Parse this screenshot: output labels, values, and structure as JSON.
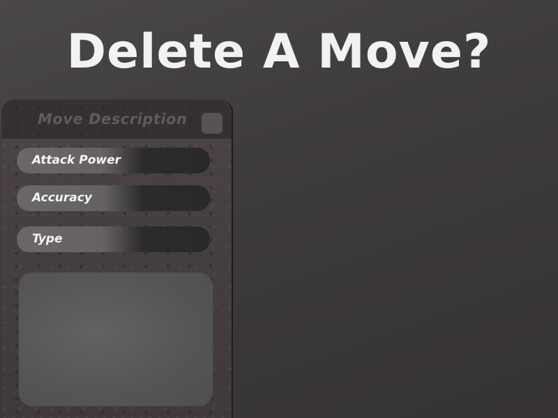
{
  "screen": {
    "title": "Delete A Move?"
  },
  "panel": {
    "header_title": "Move Description",
    "stats": [
      {
        "label": "Attack Power"
      },
      {
        "label": "Accuracy"
      },
      {
        "label": "Type"
      }
    ],
    "description_text": ""
  },
  "colors": {
    "background": "#3f3c3c",
    "title_text": "#f2f2f2",
    "panel": "#453e3f",
    "stat_bar_dark": "#2a2929",
    "description_box": "#575757"
  }
}
